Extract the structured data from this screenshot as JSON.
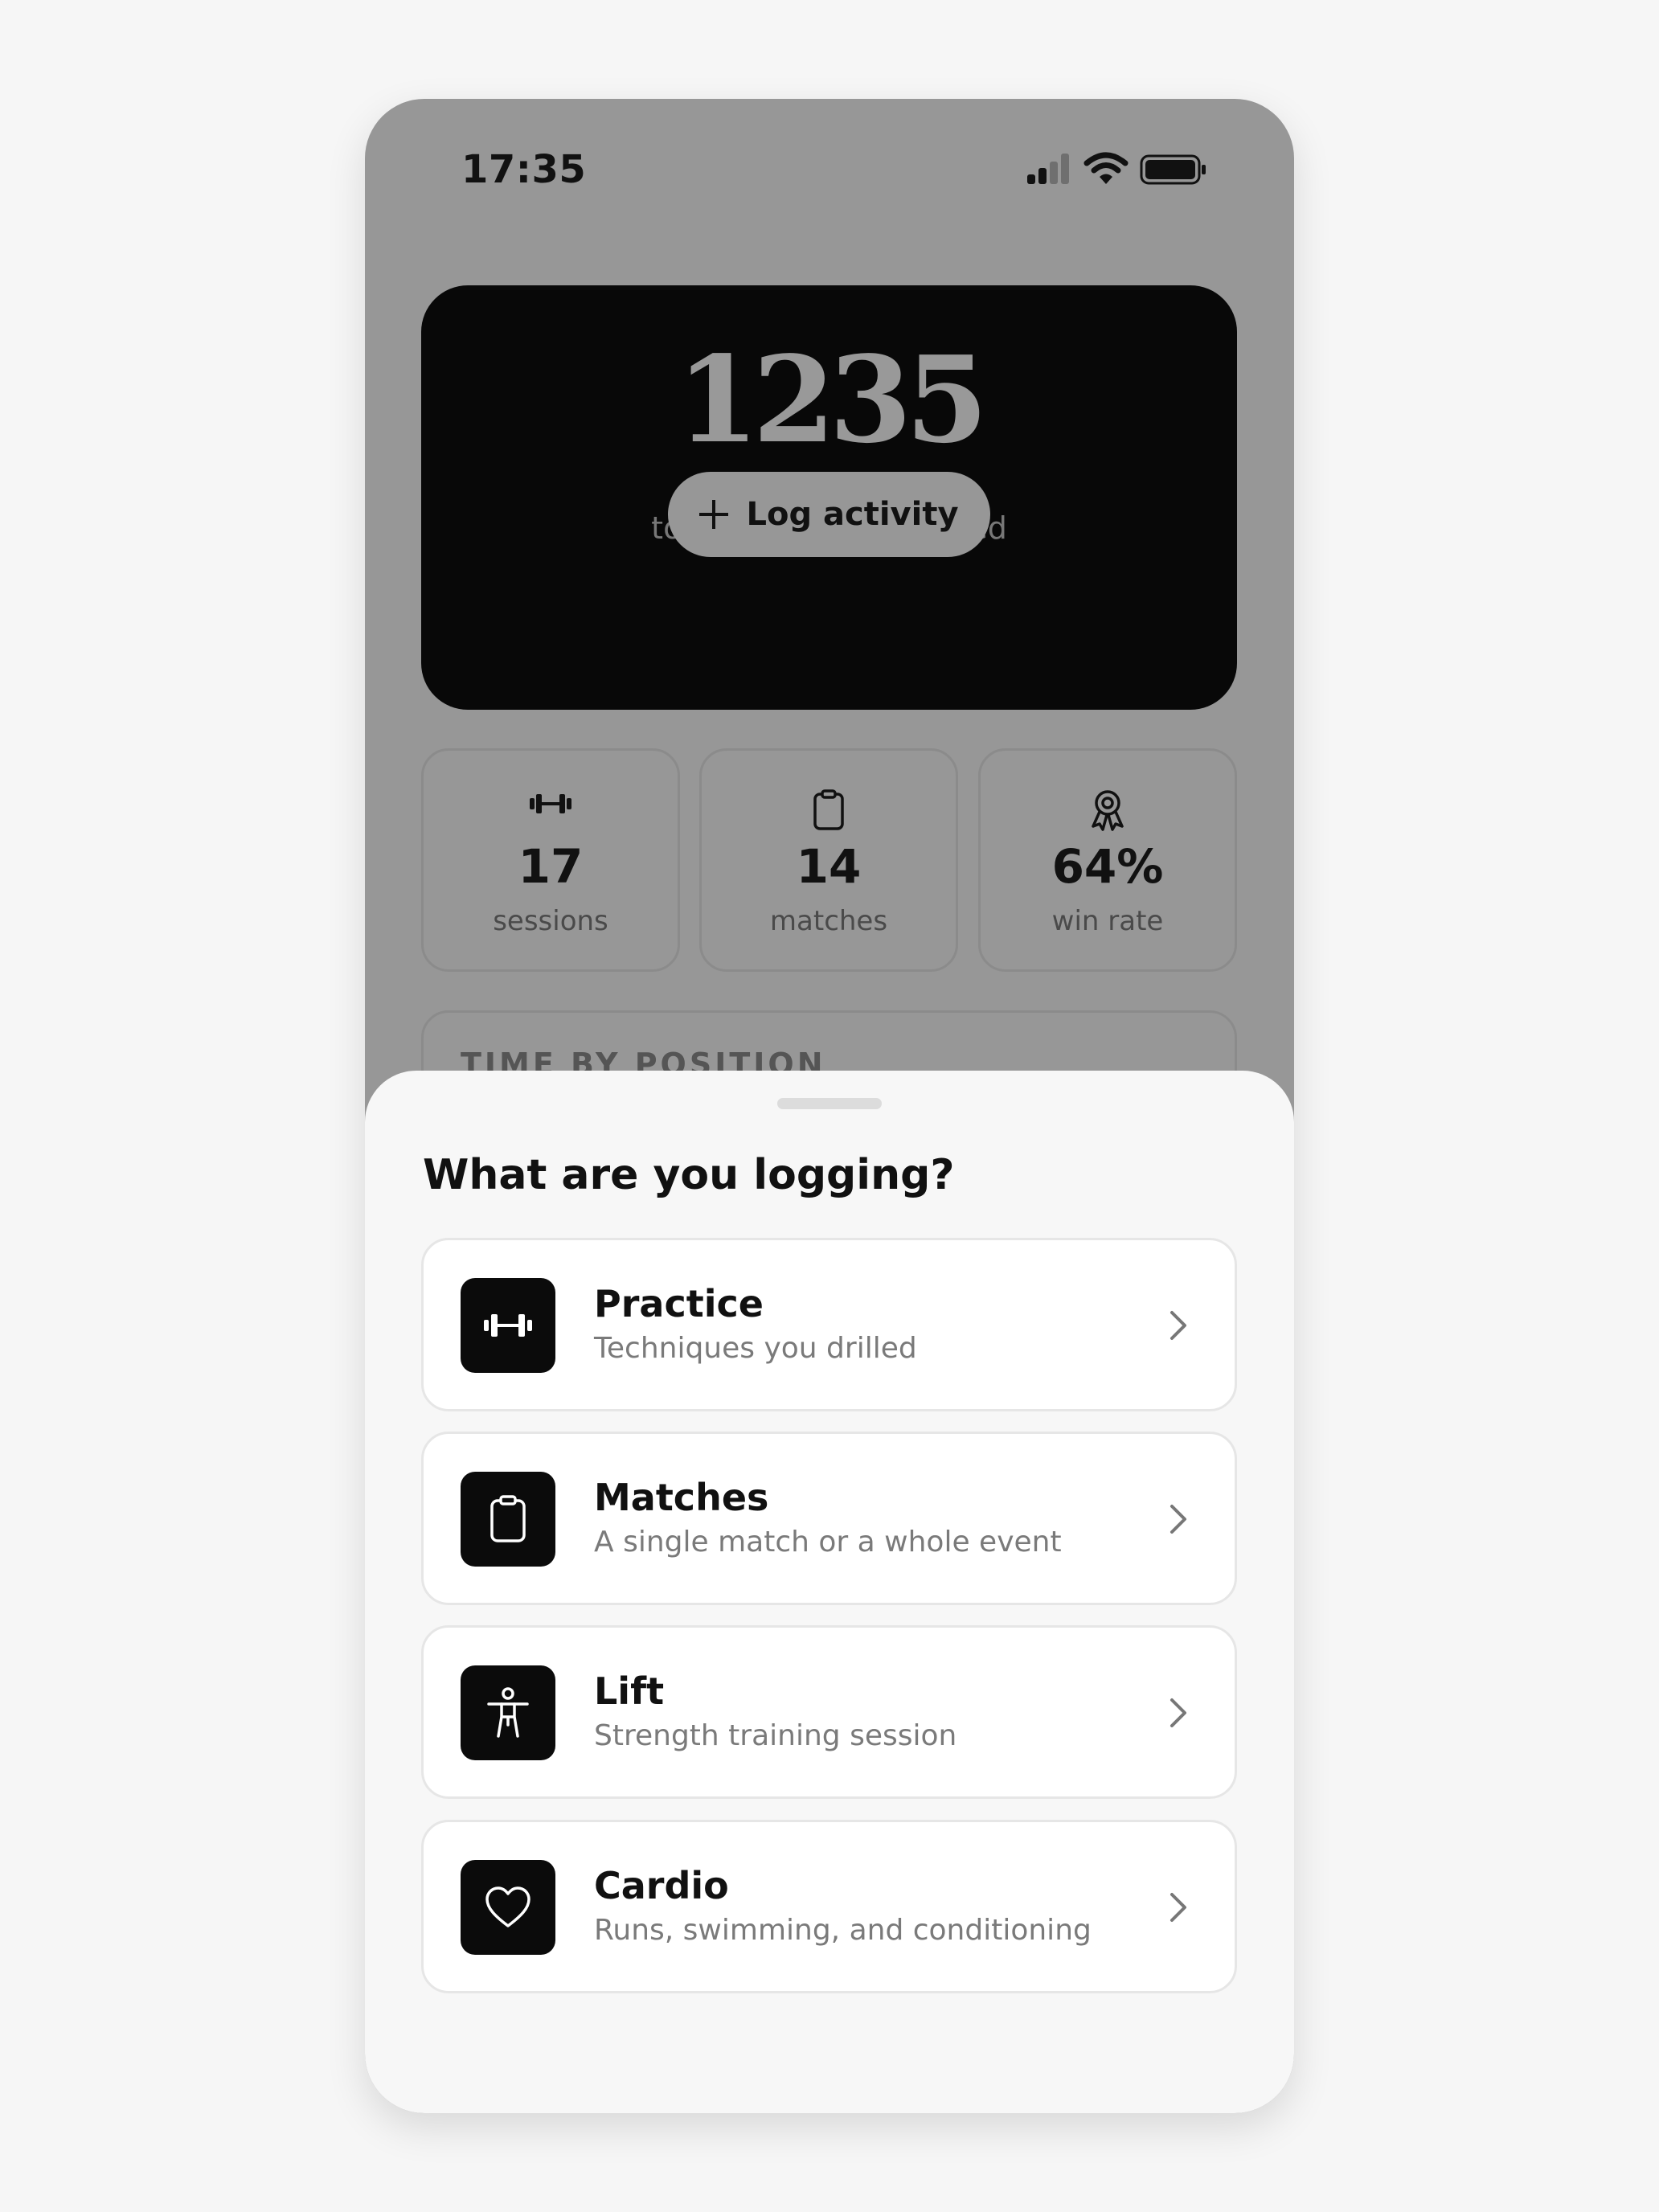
{
  "status_bar": {
    "time": "17:35",
    "icons": [
      "signal-icon",
      "wifi-icon",
      "battery-icon"
    ]
  },
  "summary": {
    "total_minutes": "1235",
    "total_label": "total minutes practiced",
    "log_button_label": "Log activity"
  },
  "stats": [
    {
      "icon": "dumbbell-icon",
      "value": "17",
      "label": "sessions"
    },
    {
      "icon": "clipboard-icon",
      "value": "14",
      "label": "matches"
    },
    {
      "icon": "award-icon",
      "value": "64%",
      "label": "win rate"
    }
  ],
  "time_by_position": {
    "title": "TIME BY POSITION"
  },
  "sheet": {
    "title": "What are you logging?",
    "options": [
      {
        "icon": "dumbbell-icon",
        "title": "Practice",
        "subtitle": "Techniques you drilled"
      },
      {
        "icon": "clipboard-icon",
        "title": "Matches",
        "subtitle": "A single match or a whole event"
      },
      {
        "icon": "person-icon",
        "title": "Lift",
        "subtitle": "Strength training session"
      },
      {
        "icon": "heart-icon",
        "title": "Cardio",
        "subtitle": "Runs, swimming, and conditioning"
      }
    ]
  },
  "colors": {
    "page_background": "#f6f6f6",
    "dimmed_background": "#979797",
    "hero_card": "#080808",
    "sheet_background": "#f7f7f7",
    "option_card": "#ffffff",
    "icon_tile": "#0b0b0b"
  }
}
